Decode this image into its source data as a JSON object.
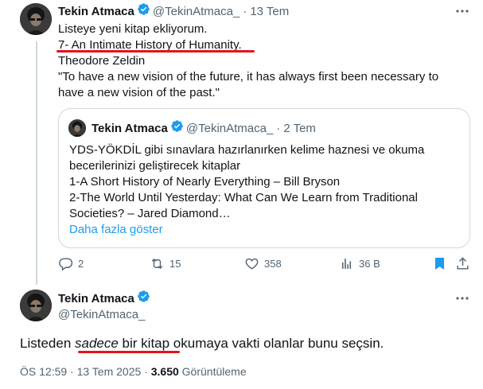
{
  "tweet1": {
    "author_name": "Tekin Atmaca",
    "handle": "@TekinAtmaca_",
    "separator": "·",
    "time": "13 Tem",
    "lines": [
      "Listeye yeni kitap ekliyorum.",
      "7- An Intimate History of Humanity.",
      "Theodore Zeldin",
      "\"To have a new vision of the future, it has always first been necessary to",
      "have a new vision of the past.\""
    ]
  },
  "quote": {
    "author_name": "Tekin Atmaca",
    "handle": "@TekinAtmaca_",
    "separator": "·",
    "time": "2 Tem",
    "lines": [
      "YDS-YÖKDİL gibi sınavlara hazırlanırken kelime haznesi ve okuma",
      "becerilerinizi geliştirecek kitaplar",
      "1-A Short History of Nearly Everything – Bill Bryson",
      "2-The World Until Yesterday: What Can We Learn from Traditional",
      "Societies? – Jared Diamond…"
    ],
    "show_more": "Daha fazla göster"
  },
  "actions": {
    "replies": "2",
    "reposts": "15",
    "likes": "358",
    "views": "36 B"
  },
  "tweet2": {
    "author_name": "Tekin Atmaca",
    "handle": "@TekinAtmaca_",
    "text_parts": [
      "Listeden ",
      "sadece",
      " bir kitap",
      " okumaya vakti olanlar bunu seçsin."
    ],
    "time": "ÖS 12:59 · 13 Tem 2025 · ",
    "views_count": "3.650",
    "views_label": " Görüntüleme"
  },
  "colors": {
    "accent": "#1d9bf0",
    "annotation_red": "#e3141b",
    "text": "#0f1419",
    "secondary": "#536471"
  }
}
